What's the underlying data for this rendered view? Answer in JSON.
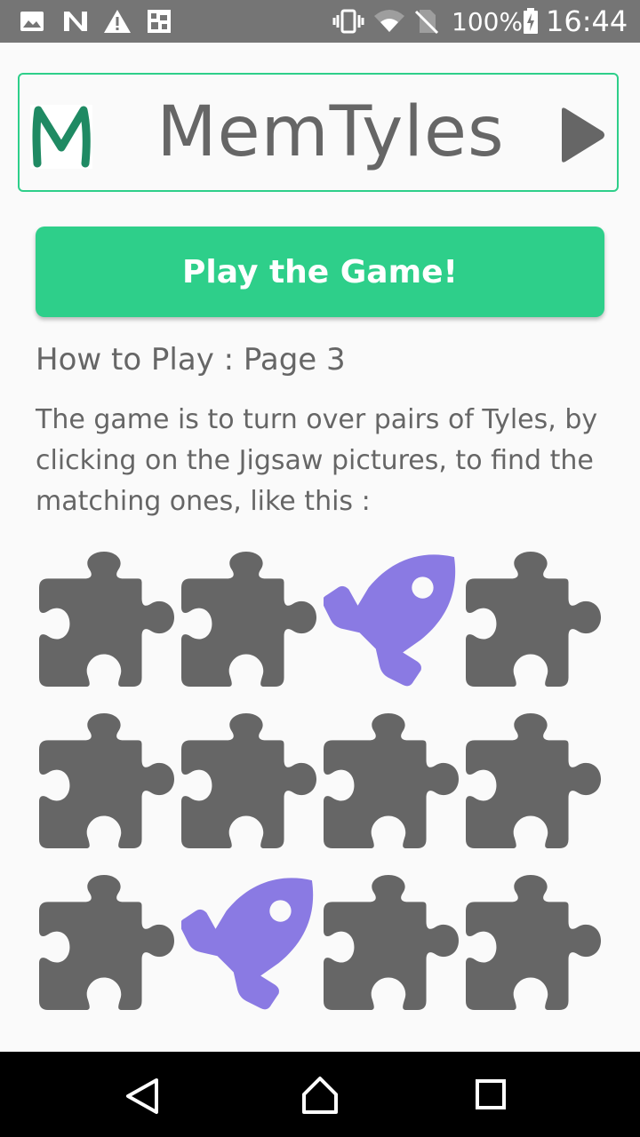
{
  "status_bar": {
    "battery": "100%",
    "time": "16:44",
    "icons": [
      "image-icon",
      "n-app-icon",
      "warning-icon",
      "photo-app-icon",
      "vibrate-icon",
      "wifi-icon",
      "no-sim-icon",
      "battery-charging-icon"
    ]
  },
  "header": {
    "logo_letter": "M",
    "title": "MemTyles",
    "logo_color": "#1f8a63",
    "next_icon": "play-arrow-icon"
  },
  "play_button": {
    "label": "Play the Game!"
  },
  "page_heading": "How to Play : Page 3",
  "instructions": "The game is to turn over pairs of Tyles, by clicking on the Jigsaw pictures, to find the matching ones, like this :",
  "tiles": [
    [
      "puzzle",
      "puzzle",
      "rocket",
      "puzzle"
    ],
    [
      "puzzle",
      "puzzle",
      "puzzle",
      "puzzle"
    ],
    [
      "puzzle",
      "rocket",
      "puzzle",
      "puzzle"
    ]
  ],
  "colors": {
    "accent": "#2ecf8a",
    "puzzle": "#666666",
    "rocket": "#8a7ae3",
    "text": "#666666",
    "status_bar": "#757575"
  },
  "nav_bar": {
    "icons": [
      "back-icon",
      "home-icon",
      "recents-icon"
    ]
  }
}
